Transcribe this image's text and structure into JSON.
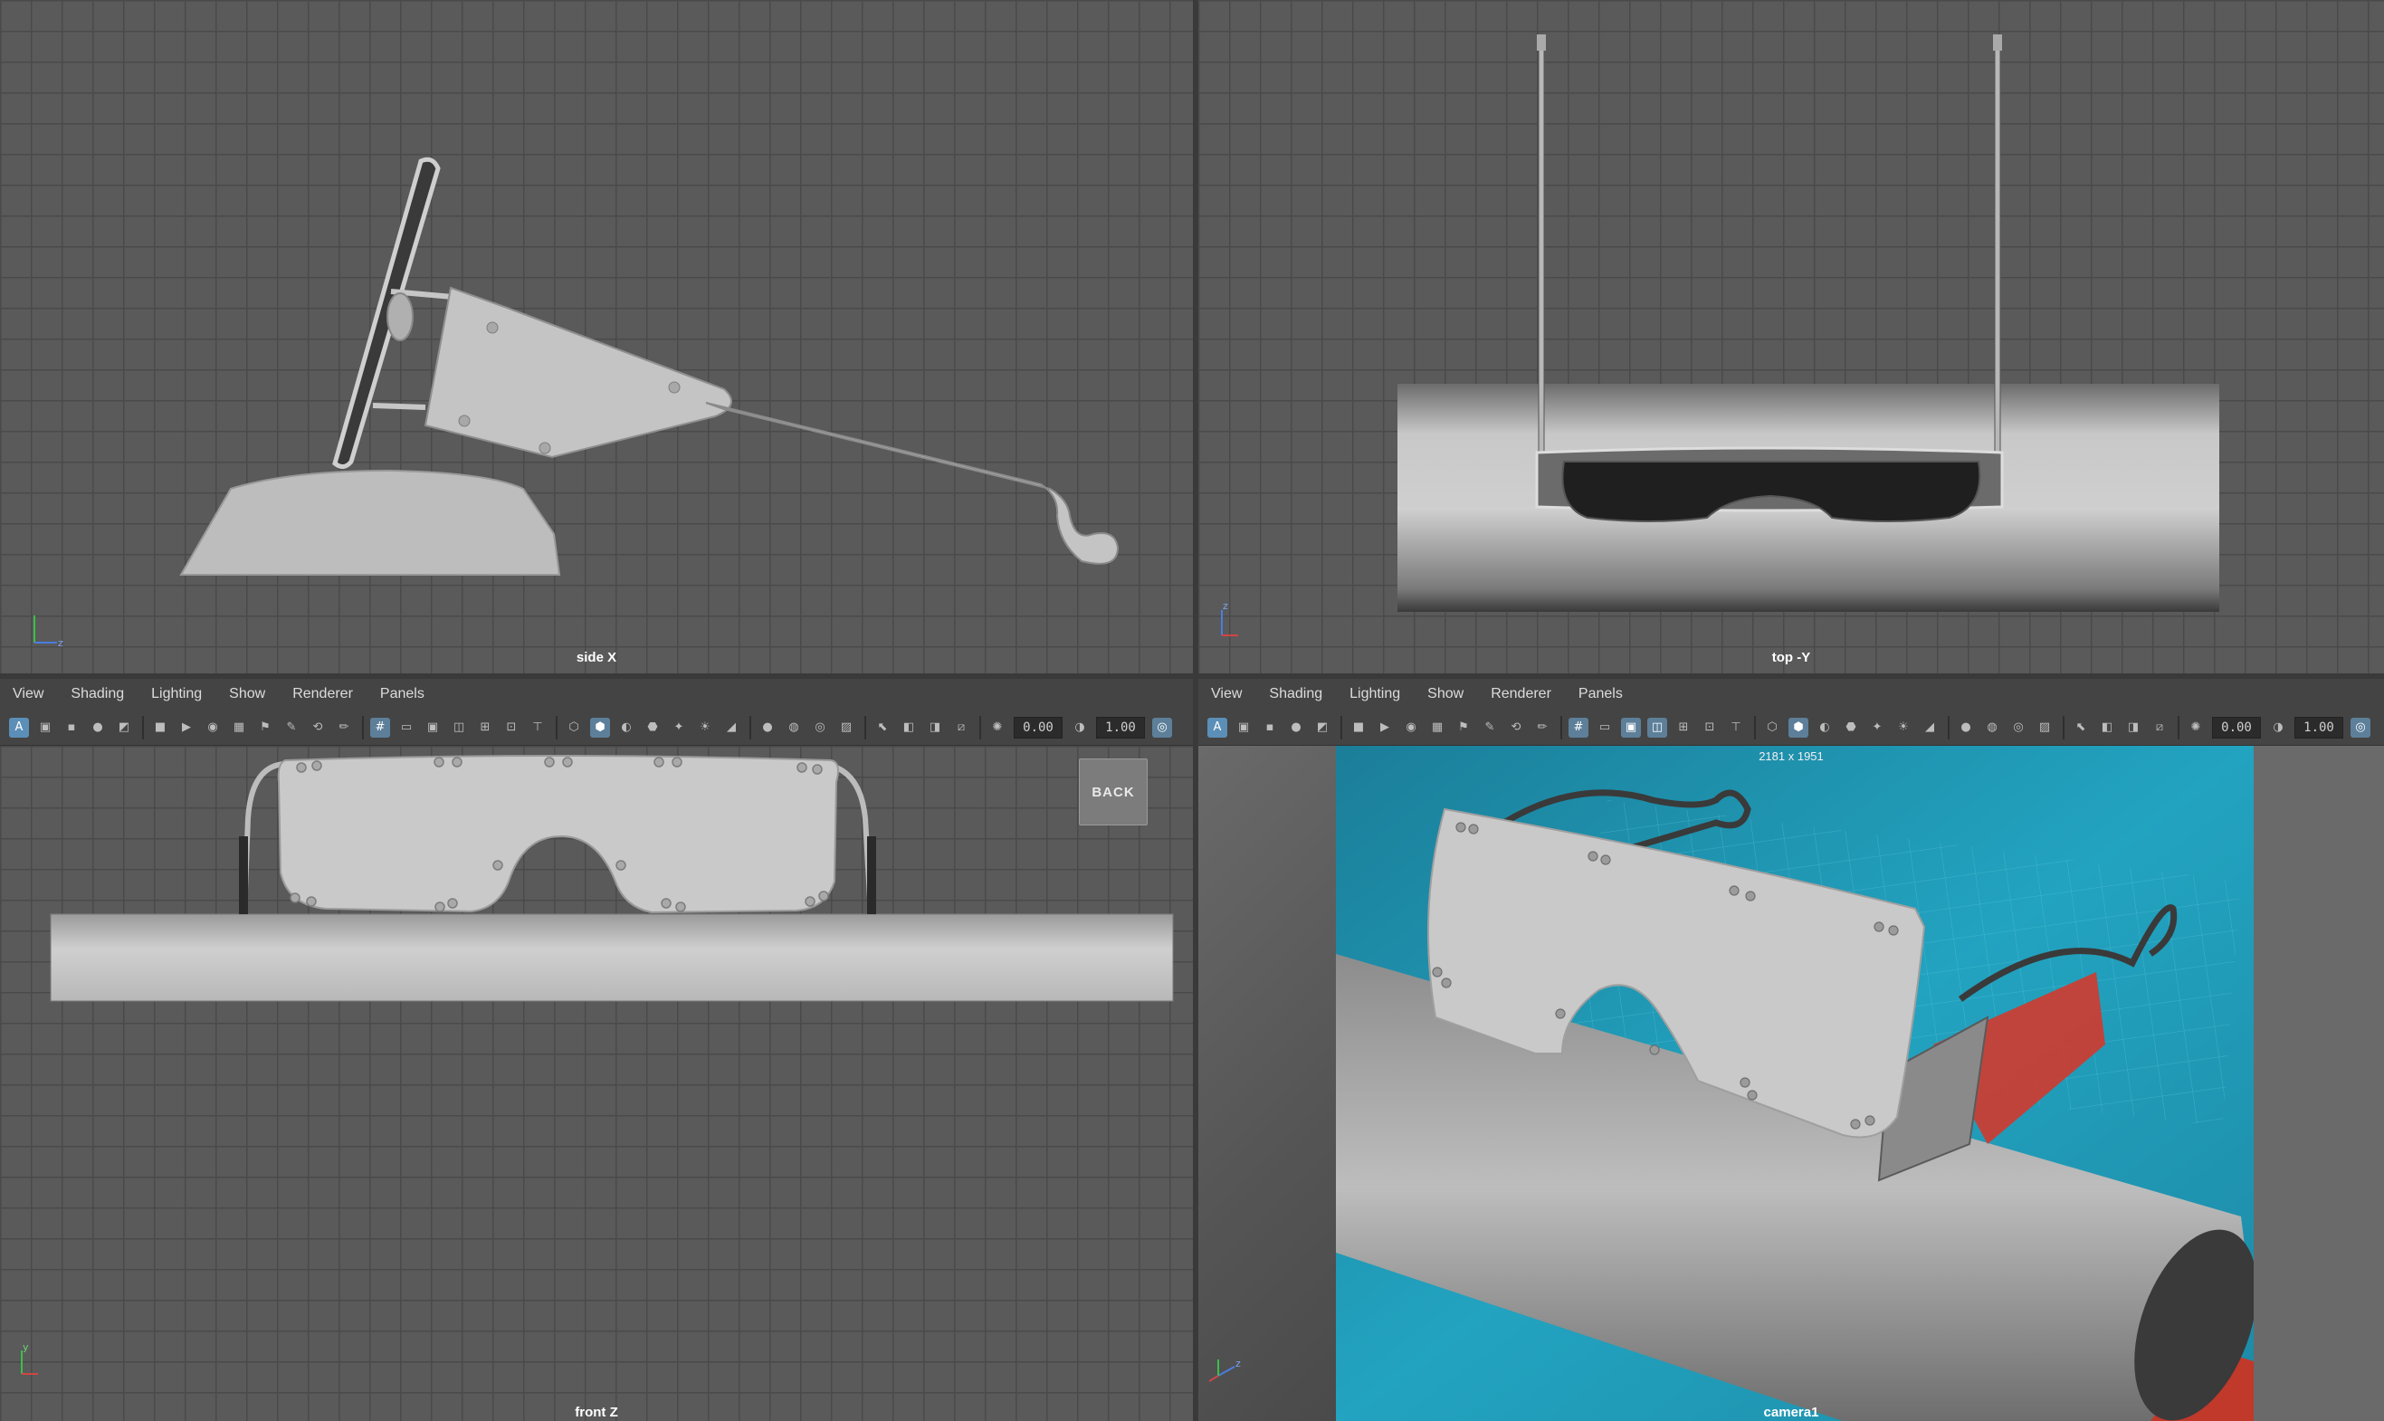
{
  "viewports": {
    "side": {
      "label": "side X"
    },
    "top": {
      "label": "top -Y"
    },
    "front": {
      "label": "front Z",
      "back_label": "BACK"
    },
    "camera": {
      "label": "camera1",
      "resolution": "2181 x 1951"
    }
  },
  "menu": [
    "View",
    "Shading",
    "Lighting",
    "Show",
    "Renderer",
    "Panels"
  ],
  "toolbar": {
    "near_clip": "0.00",
    "far_clip": "1.00"
  },
  "axes": {
    "x": "x",
    "y": "y",
    "z": "z"
  },
  "colors": {
    "viewport_bg": "#5a5a5a",
    "grid_line": "#4a4a4a",
    "model_gray": "#b4b4b4",
    "render_teal": "#1e94b0",
    "render_red": "#c83a30",
    "accent_blue": "#5b8fb8"
  }
}
